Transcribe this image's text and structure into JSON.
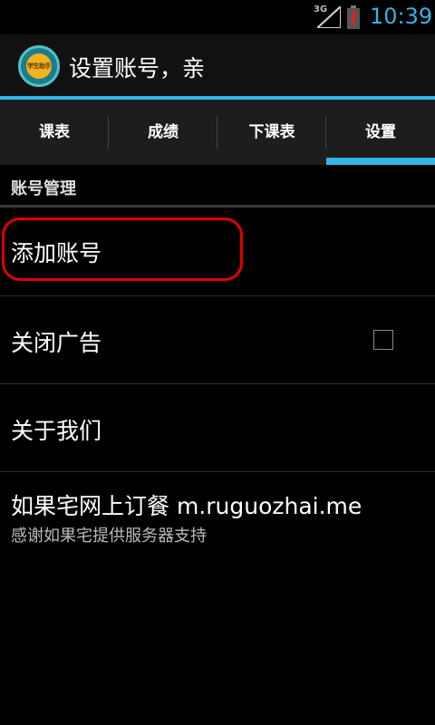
{
  "status_bar": {
    "network": "3G",
    "time": "10:39",
    "time_color": "#33b5e5"
  },
  "action_bar": {
    "logo_text": "学生助手",
    "title": "设置账号，亲"
  },
  "tabs": [
    {
      "label": "课表",
      "selected": false
    },
    {
      "label": "成绩",
      "selected": false
    },
    {
      "label": "下课表",
      "selected": false
    },
    {
      "label": "设置",
      "selected": true
    }
  ],
  "section": {
    "header": "账号管理"
  },
  "list": [
    {
      "label": "添加账号",
      "highlighted": true
    },
    {
      "label": "关闭广告",
      "checkbox": true,
      "checked": false
    },
    {
      "label": "关于我们"
    },
    {
      "label": "如果宅网上订餐 m.ruguozhai.me",
      "subtext": "感谢如果宅提供服务器支持"
    }
  ],
  "colors": {
    "accent": "#33b5e5",
    "highlight_border": "#e00000",
    "background": "#000000"
  }
}
